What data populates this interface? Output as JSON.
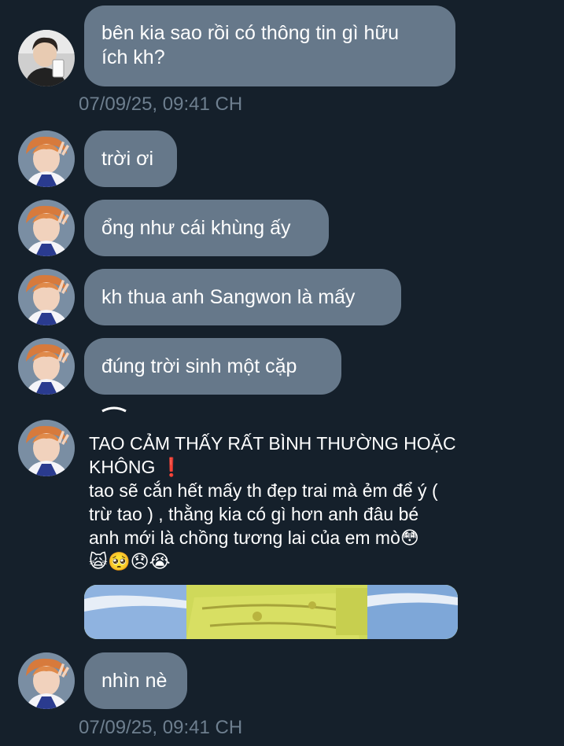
{
  "conversation": {
    "message_1": {
      "text_line1": "bên kia sao rồi có thông tin gì hữu",
      "text_line2": "ích kh?"
    },
    "timestamp_1": "07/09/25, 09:41 CH",
    "message_2": "trời ơi",
    "message_3": "ổng như cái khùng ấy",
    "message_4": "kh thua anh Sangwon là mấy",
    "message_5": "đúng trời sinh một cặp",
    "message_6": {
      "line1": "TAO CẢM THẤY RẤT BÌNH THƯỜNG HOẶC",
      "line2": "KHÔNG",
      "line2_emoji": "❗",
      "line3": "tao sẽ cắn hết mấy th đẹp trai mà ẻm để ý (",
      "line4": "trừ tao ) , thằng kia có gì hơn anh đâu bé",
      "line5": "anh mới là chồng tương lai của em mò😳",
      "emoji_row": "🙀🥺😞😭"
    },
    "message_7": "nhìn nè",
    "timestamp_2": "07/09/25, 09:41 CH"
  },
  "colors": {
    "background": "#15202b",
    "bubble": "#66788a",
    "timestamp": "#6e7f8f",
    "text": "#ffffff"
  },
  "icons": {
    "avatar_1": "avatar-boy-with-phone",
    "avatar_2": "avatar-orange-hair-peace-sign"
  }
}
